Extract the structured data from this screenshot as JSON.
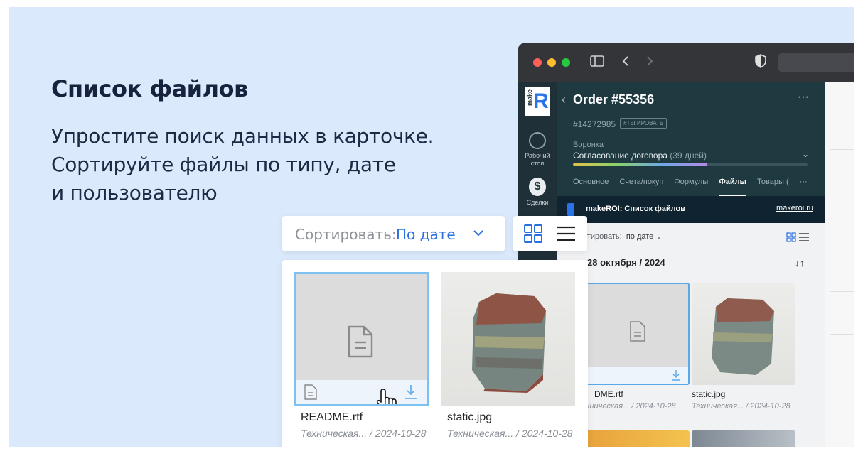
{
  "hero": {
    "title": "Список файлов",
    "lines": [
      "Упростите поиск данных в карточке.",
      "Сортируйте файлы по типу, дате",
      "и пользователю"
    ]
  },
  "sort": {
    "label": "Сортировать:",
    "value": "По дате"
  },
  "files": [
    {
      "name": "README.rtf",
      "meta": "Техническая...  / 2024-10-28"
    },
    {
      "name": "static.jpg",
      "meta": "Техническая...  / 2024-10-28"
    }
  ],
  "browser": {
    "sidebar": {
      "logo_small": "make",
      "logo_letter": "R",
      "dashboard_label": "Рабочий стол",
      "deals_label": "Сделки"
    },
    "order": {
      "title": "Order #55356",
      "more": "···",
      "number": "#14272985",
      "tag_button": "#ТЕГИРОВАТЬ",
      "funnel_label": "Воронка",
      "funnel_stage": "Согласование договора",
      "funnel_days": "(39 дней)",
      "funnel_progress": 0.57,
      "tabs": [
        "Основное",
        "Счета/покуп",
        "Формулы",
        "Файлы",
        "Товары ("
      ],
      "active_tab": "Файлы",
      "tabs_more": "···"
    },
    "app": {
      "title": "makeROI: Список файлов",
      "link": "makeroi.ru",
      "sort_label": "ртировать:",
      "sort_value": "по дате",
      "date_header": "28 октября / 2024",
      "files": [
        {
          "name": "DME.rtf",
          "meta": "хническая...  / 2024-10-28"
        },
        {
          "name": "static.jpg",
          "meta": "Техническая...  / 2024-10-28"
        }
      ]
    }
  },
  "colors": {
    "background": "#dae9fc",
    "accent": "#2a6fe0",
    "selection": "#7ec0ef",
    "crm_header": "#1f3941"
  }
}
